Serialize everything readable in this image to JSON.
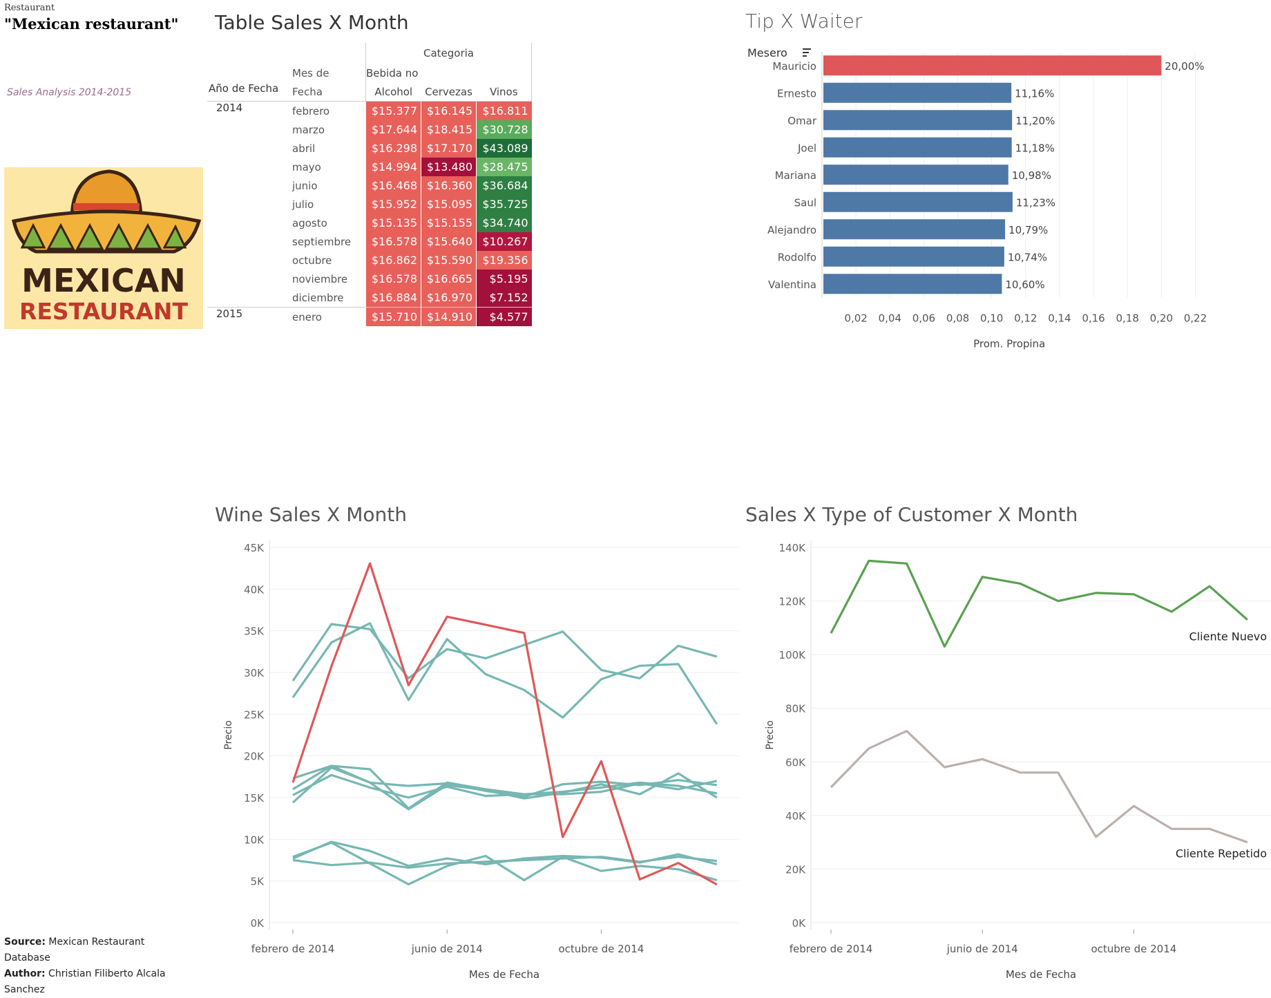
{
  "header": {
    "small_title": "Restaurant",
    "main_title": "\"Mexican restaurant\"",
    "subtitle": "Sales Analysis 2014-2015"
  },
  "logo": {
    "line1": "MEXICAN",
    "line2": "RESTAURANT",
    "colors": {
      "bg": "#fde7a6",
      "hat": "#e89b2b",
      "brim": "#f2b33d",
      "band": "#d9452e",
      "triangles": "#7cb342",
      "text1": "#3b2416",
      "text2": "#c0392b"
    }
  },
  "table": {
    "title": "Table Sales X Month",
    "col_group": "Categoria",
    "row_header_year": "Año de Fecha",
    "row_header_month_1": "Mes de",
    "row_header_month_2": "Fecha",
    "columns": [
      {
        "line1": "Bebida no",
        "line2": "Alcohol"
      },
      {
        "line1": "",
        "line2": "Cervezas"
      },
      {
        "line1": "",
        "line2": "Vinos"
      }
    ],
    "rows": [
      {
        "year": "2014",
        "month": "febrero",
        "values": [
          "$15.377",
          "$16.145",
          "$16.811"
        ],
        "colors": [
          "#e8605a",
          "#e8605a",
          "#e8605a"
        ]
      },
      {
        "year": "",
        "month": "marzo",
        "values": [
          "$17.644",
          "$18.415",
          "$30.728"
        ],
        "colors": [
          "#e8605a",
          "#e8605a",
          "#5aab5c"
        ]
      },
      {
        "year": "",
        "month": "abril",
        "values": [
          "$16.298",
          "$17.170",
          "$43.089"
        ],
        "colors": [
          "#e8605a",
          "#e8605a",
          "#1e6d38"
        ]
      },
      {
        "year": "",
        "month": "mayo",
        "values": [
          "$14.994",
          "$13.480",
          "$28.475"
        ],
        "colors": [
          "#e8605a",
          "#a3103c",
          "#6bb568"
        ]
      },
      {
        "year": "",
        "month": "junio",
        "values": [
          "$16.468",
          "$16.360",
          "$36.684"
        ],
        "colors": [
          "#e8605a",
          "#e8605a",
          "#2e7f42"
        ]
      },
      {
        "year": "",
        "month": "julio",
        "values": [
          "$15.952",
          "$15.095",
          "$35.725"
        ],
        "colors": [
          "#e8605a",
          "#e8605a",
          "#2e7f42"
        ]
      },
      {
        "year": "",
        "month": "agosto",
        "values": [
          "$15.135",
          "$15.155",
          "$34.740"
        ],
        "colors": [
          "#e8605a",
          "#e8605a",
          "#327f45"
        ]
      },
      {
        "year": "",
        "month": "septiembre",
        "values": [
          "$16.578",
          "$15.640",
          "$10.267"
        ],
        "colors": [
          "#e8605a",
          "#e8605a",
          "#b0163e"
        ]
      },
      {
        "year": "",
        "month": "octubre",
        "values": [
          "$16.862",
          "$15.590",
          "$19.356"
        ],
        "colors": [
          "#e8605a",
          "#e8605a",
          "#e8605a"
        ]
      },
      {
        "year": "",
        "month": "noviembre",
        "values": [
          "$16.578",
          "$16.665",
          "$5.195"
        ],
        "colors": [
          "#e8605a",
          "#e8605a",
          "#a3103c"
        ]
      },
      {
        "year": "",
        "month": "diciembre",
        "values": [
          "$16.884",
          "$16.970",
          "$7.152"
        ],
        "colors": [
          "#e8605a",
          "#e8605a",
          "#a3103c"
        ]
      },
      {
        "year": "2015",
        "month": "enero",
        "values": [
          "$15.710",
          "$14.910",
          "$4.577"
        ],
        "colors": [
          "#e8605a",
          "#e8605a",
          "#a3103c"
        ]
      }
    ]
  },
  "chart_data": [
    {
      "type": "bar",
      "orientation": "horizontal",
      "title": "Tip X Waiter",
      "category_label": "Mesero",
      "xlabel": "Prom. Propina",
      "xlim": [
        0,
        0.23
      ],
      "xticks": [
        "0,02",
        "0,04",
        "0,06",
        "0,08",
        "0,10",
        "0,12",
        "0,14",
        "0,16",
        "0,18",
        "0,20",
        "0,22"
      ],
      "categories": [
        "Mauricio",
        "Ernesto",
        "Omar",
        "Joel",
        "Mariana",
        "Saul",
        "Alejandro",
        "Rodolfo",
        "Valentina"
      ],
      "values": [
        0.2,
        0.1116,
        0.112,
        0.1118,
        0.1098,
        0.1123,
        0.1079,
        0.1074,
        0.106
      ],
      "labels": [
        "20,00%",
        "11,16%",
        "11,20%",
        "11,18%",
        "10,98%",
        "11,23%",
        "10,79%",
        "10,74%",
        "10,60%"
      ],
      "colors": [
        "#e05759",
        "#4e79a7",
        "#4e79a7",
        "#4e79a7",
        "#4e79a7",
        "#4e79a7",
        "#4e79a7",
        "#4e79a7",
        "#4e79a7"
      ],
      "grid": true
    },
    {
      "type": "line",
      "title": "Wine Sales X Month",
      "xlabel": "Mes de Fecha",
      "ylabel": "Precio",
      "ylim": [
        0,
        45000
      ],
      "yticks": [
        "0K",
        "5K",
        "10K",
        "15K",
        "20K",
        "25K",
        "30K",
        "35K",
        "40K",
        "45K"
      ],
      "xtick_labels": [
        {
          "index": 0,
          "label": "febrero de 2014"
        },
        {
          "index": 4,
          "label": "junio de 2014"
        },
        {
          "index": 8,
          "label": "octubre de 2014"
        }
      ],
      "x": [
        "2014-02",
        "2014-03",
        "2014-04",
        "2014-05",
        "2014-06",
        "2014-07",
        "2014-08",
        "2014-09",
        "2014-10",
        "2014-11",
        "2014-12",
        "2015-01"
      ],
      "series": [
        {
          "color": "#e05759",
          "values": [
            16811,
            30728,
            43089,
            28475,
            36684,
            35725,
            34740,
            10267,
            19356,
            5195,
            7152,
            4577
          ]
        },
        {
          "color": "#76b7b2",
          "values": [
            29000,
            35800,
            35200,
            29300,
            32800,
            31700,
            33300,
            34900,
            30300,
            29300,
            33200,
            31900
          ]
        },
        {
          "color": "#76b7b2",
          "values": [
            27000,
            33600,
            35900,
            26700,
            34000,
            29800,
            27900,
            24600,
            29200,
            30800,
            31000,
            23800
          ]
        },
        {
          "color": "#76b7b2",
          "values": [
            17300,
            18800,
            18400,
            13700,
            16800,
            16000,
            15400,
            15700,
            16200,
            16800,
            16400,
            15500
          ]
        },
        {
          "color": "#76b7b2",
          "values": [
            16000,
            18800,
            16800,
            16400,
            16700,
            15800,
            15100,
            16600,
            16900,
            16500,
            17100,
            16500
          ]
        },
        {
          "color": "#76b7b2",
          "values": [
            15300,
            17700,
            16200,
            15000,
            16300,
            15200,
            15400,
            15400,
            15700,
            16700,
            16000,
            17000
          ]
        },
        {
          "color": "#76b7b2",
          "values": [
            14400,
            18600,
            16800,
            13600,
            16500,
            15900,
            14900,
            15600,
            16600,
            15400,
            17900,
            15000
          ]
        },
        {
          "color": "#76b7b2",
          "values": [
            7700,
            9700,
            8600,
            6800,
            7700,
            7000,
            7700,
            8000,
            7800,
            7200,
            8200,
            7000
          ]
        },
        {
          "color": "#76b7b2",
          "values": [
            7500,
            6900,
            7200,
            6600,
            7100,
            7300,
            7500,
            7700,
            7900,
            7300,
            7900,
            7400
          ]
        },
        {
          "color": "#76b7b2",
          "values": [
            7900,
            9600,
            7100,
            4600,
            6800,
            8000,
            5100,
            7900,
            6200,
            6800,
            6400,
            5100
          ]
        }
      ],
      "grid": true
    },
    {
      "type": "line",
      "title": "Sales X Type of Customer X Month",
      "xlabel": "Mes de Fecha",
      "ylabel": "Precio",
      "ylim": [
        0,
        140000
      ],
      "yticks": [
        "0K",
        "20K",
        "40K",
        "60K",
        "80K",
        "100K",
        "120K",
        "140K"
      ],
      "xtick_labels": [
        {
          "index": 0,
          "label": "febrero de 2014"
        },
        {
          "index": 4,
          "label": "junio de 2014"
        },
        {
          "index": 8,
          "label": "octubre de 2014"
        }
      ],
      "x": [
        "2014-02",
        "2014-03",
        "2014-04",
        "2014-05",
        "2014-06",
        "2014-07",
        "2014-08",
        "2014-09",
        "2014-10",
        "2014-11",
        "2014-12",
        "2015-01"
      ],
      "series": [
        {
          "name": "Cliente Nuevo",
          "color": "#59a14f",
          "values": [
            108000,
            135000,
            134000,
            103000,
            129000,
            126500,
            120000,
            123000,
            122500,
            116000,
            125500,
            113000
          ]
        },
        {
          "name": "Cliente Repetido",
          "color": "#bab0ac",
          "values": [
            50500,
            65000,
            71500,
            58000,
            61000,
            56000,
            56000,
            32000,
            43500,
            35000,
            35000,
            30000
          ]
        }
      ],
      "grid": true
    }
  ],
  "footer": {
    "source_label": "Source:",
    "source_value": "Mexican Restaurant Database",
    "author_label": "Author:",
    "author_value": "Christian Filiberto Alcala Sanchez"
  }
}
